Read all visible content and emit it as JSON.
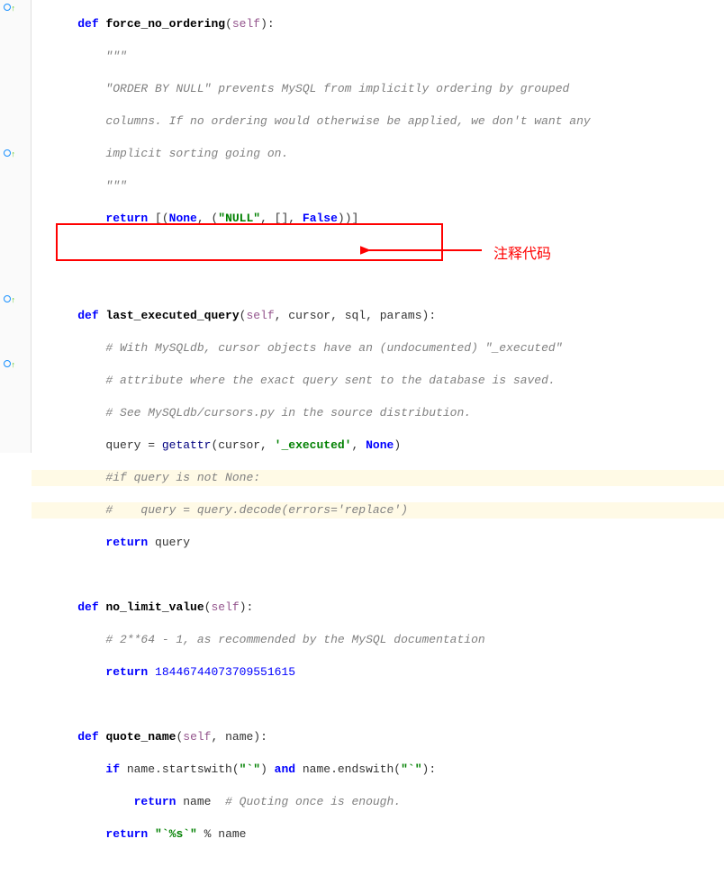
{
  "annotation": {
    "label": "注释代码"
  },
  "code": {
    "l1_def": "def",
    "l1_fn": "force_no_ordering",
    "l1_self": "self",
    "l1_end": "):",
    "l2": "\"\"\"",
    "l3": "\"ORDER BY NULL\" prevents MySQL from implicitly ordering by grouped",
    "l4": "columns. If no ordering would otherwise be applied, we don't want any",
    "l5": "implicit sorting going on.",
    "l6": "\"\"\"",
    "l7_ret": "return",
    "l7_rest1": " [(",
    "l7_none1": "None",
    "l7_rest2": ", (",
    "l7_str": "\"NULL\"",
    "l7_rest3": ", [], ",
    "l7_false": "False",
    "l7_rest4": "))]",
    "l9_def": "def",
    "l9_fn": "last_executed_query",
    "l9_self": "self",
    "l9_params": ", cursor, sql, params):",
    "l10": "# With MySQLdb, cursor objects have an (undocumented) \"_executed\"",
    "l11": "# attribute where the exact query sent to the database is saved.",
    "l12": "# See MySQLdb/cursors.py in the source distribution.",
    "l13_a": "query = ",
    "l13_getattr": "getattr",
    "l13_b": "(cursor, ",
    "l13_str": "'_executed'",
    "l13_c": ", ",
    "l13_none": "None",
    "l13_d": ")",
    "l14": "#if query is not None:",
    "l15": "#    query = query.decode(errors='replace')",
    "l16_ret": "return",
    "l16_rest": " query",
    "l18_def": "def",
    "l18_fn": "no_limit_value",
    "l18_self": "self",
    "l18_end": "):",
    "l19": "# 2**64 - 1, as recommended by the MySQL documentation",
    "l20_ret": "return",
    "l20_num": " 18446744073709551615",
    "l22_def": "def",
    "l22_fn": "quote_name",
    "l22_self": "self",
    "l22_params": ", name):",
    "l23_if": "if",
    "l23_a": " name.startswith(",
    "l23_s1": "\"`\"",
    "l23_b": ") ",
    "l23_and": "and",
    "l23_c": " name.endswith(",
    "l23_s2": "\"`\"",
    "l23_d": "):",
    "l24_ret": "return",
    "l24_a": " name  ",
    "l24_com": "# Quoting once is enough.",
    "l25_ret": "return",
    "l25_a": " ",
    "l25_str": "\"`%s`\"",
    "l25_b": " % name"
  }
}
